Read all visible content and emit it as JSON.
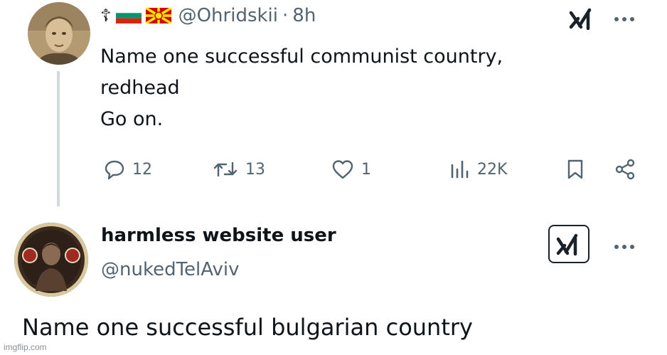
{
  "tweet1": {
    "cross_glyph": "☦",
    "flags": [
      "bulgaria",
      "north-macedonia"
    ],
    "handle": "@Ohridskii",
    "separator": "·",
    "time": "8h",
    "text_lines": [
      "Name one successful communist country,",
      "redhead",
      "Go on."
    ],
    "stats": {
      "replies": "12",
      "reposts": "13",
      "likes": "1",
      "views": "22K"
    },
    "icons": [
      "grok-icon",
      "more-icon",
      "reply-icon",
      "repost-icon",
      "like-icon",
      "views-icon",
      "bookmark-icon",
      "share-icon"
    ]
  },
  "tweet2": {
    "display_name": "harmless website user",
    "handle": "@nukedTelAviv",
    "text": "Name one successful bulgarian country",
    "icons": [
      "grok-icon",
      "more-icon"
    ]
  },
  "footer": {
    "watermark": "imgflip.com"
  },
  "colors": {
    "text": "#0f1419",
    "muted": "#536471",
    "thread_line": "#cfd9de",
    "background": "#ffffff"
  }
}
